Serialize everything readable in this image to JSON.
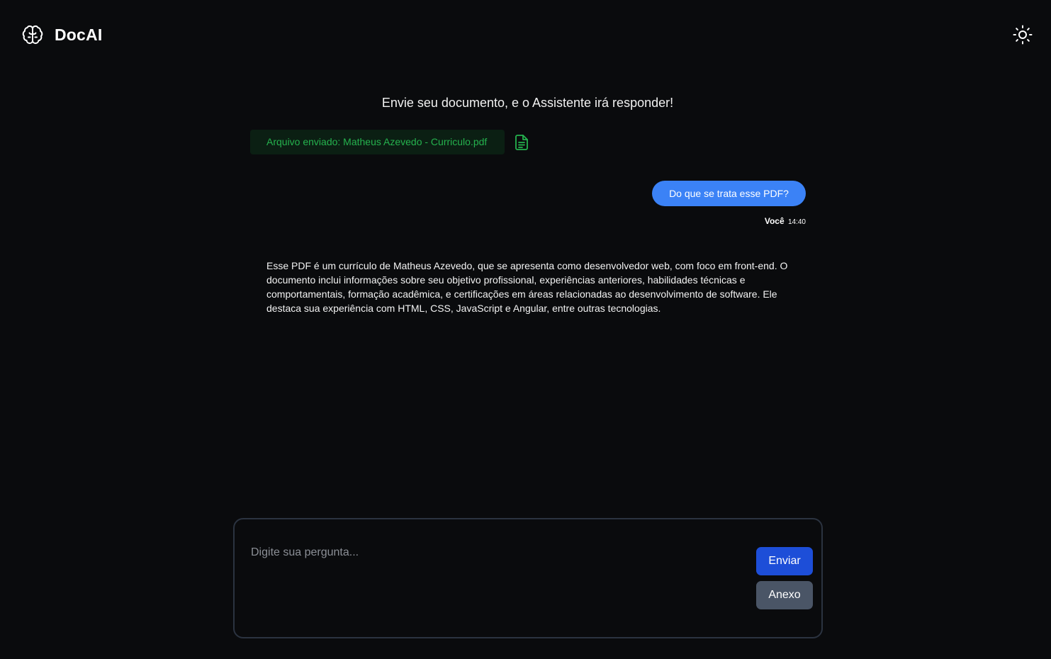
{
  "header": {
    "app_name": "DocAI",
    "logo_icon": "brain-icon",
    "theme_toggle_icon": "sun-icon"
  },
  "chat": {
    "intro": "Envie seu documento, e o Assistente irá responder!",
    "uploaded_file": "Arquivo enviado: Matheus Azevedo - Curriculo.pdf",
    "file_icon": "file-text-icon",
    "messages": [
      {
        "role": "user",
        "text": "Do que se trata esse PDF?",
        "author": "Você",
        "time": "14:40"
      },
      {
        "role": "assistant",
        "text": "Esse PDF é um currículo de Matheus Azevedo, que se apresenta como desenvolvedor web, com foco em front-end. O documento inclui informações sobre seu objetivo profissional, experiências anteriores, habilidades técnicas e comportamentais, formação acadêmica, e certificações em áreas relacionadas ao desenvolvimento de software. Ele destaca sua experiência com HTML, CSS, JavaScript e Angular, entre outras tecnologias."
      }
    ]
  },
  "composer": {
    "placeholder": "Digite sua pergunta...",
    "value": "",
    "send_label": "Enviar",
    "attach_label": "Anexo"
  },
  "colors": {
    "background": "#0a0b0d",
    "user_bubble": "#3b82f6",
    "send_button": "#1d4ed8",
    "attach_button": "#4a5566",
    "file_chip_text": "#25b24e",
    "file_chip_bg": "#0b1f13"
  }
}
